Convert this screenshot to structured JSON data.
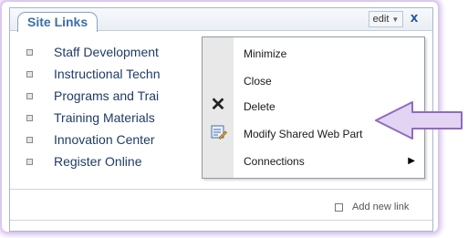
{
  "webpart": {
    "title": "Site Links",
    "edit_label": "edit",
    "close_label": "x",
    "links": [
      "Staff Development",
      "Instructional Techn",
      "Programs and Trai",
      "Training Materials",
      "Innovation Center",
      "Register Online"
    ],
    "add_new_link": "Add new link"
  },
  "context_menu": {
    "items": [
      {
        "label": "Minimize"
      },
      {
        "label": "Close"
      },
      {
        "label": "Delete",
        "icon": "delete-x-icon"
      },
      {
        "label": "Modify Shared Web Part",
        "icon": "edit-web-part-icon"
      },
      {
        "label": "Connections",
        "has_submenu": true
      }
    ]
  },
  "colors": {
    "glow": "#d9c6ee",
    "title_text": "#3a6fa8",
    "link_text": "#1f3b66",
    "arrow_fill": "#e4d4f4",
    "arrow_stroke": "#8e6bbf"
  }
}
